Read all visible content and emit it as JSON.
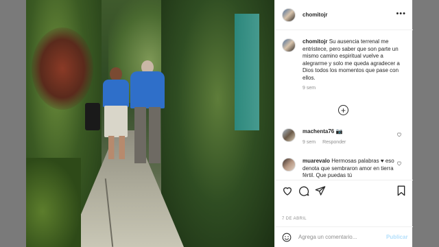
{
  "post": {
    "author": "chomitojr",
    "more_label": "•••",
    "caption": {
      "author": "chomitojr",
      "text": "Su ausencia terrenal me entristece, pero saber que son parte un mismo camino espiritual vuelve a alegrarme y solo me queda agradecer a Dios todos los momentos que pase con ellos.",
      "age": "9 sem"
    },
    "load_more_label": "+",
    "comments": [
      {
        "author": "machenta76",
        "text": "📷",
        "age": "9 sem",
        "reply_label": "Responder"
      },
      {
        "author": "muarevalo",
        "text": "Hermosas palabras ♥ eso denota que sembraron amor en tierra fértil. Que puedas tú"
      }
    ],
    "date": "7 DE ABRIL",
    "comment_input": {
      "placeholder": "Agrega un comentario...",
      "value": ""
    },
    "publish_label": "Publicar"
  },
  "icons": {
    "like": "heart-icon",
    "comment": "comment-icon",
    "share": "share-icon",
    "save": "bookmark-icon",
    "emoji": "emoji-icon",
    "comment_like": "small-heart-icon"
  },
  "colors": {
    "text": "#262626",
    "muted": "#8e8e8e",
    "publish": "#b2dffc",
    "backdrop": "#7a7a7a"
  }
}
